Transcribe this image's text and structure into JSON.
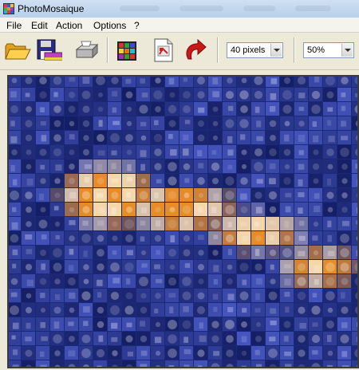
{
  "titlebar": {
    "title": "PhotoMosaique"
  },
  "menu": {
    "items": [
      {
        "label": "File"
      },
      {
        "label": "Edit"
      },
      {
        "label": "Action"
      },
      {
        "label": "Options"
      },
      {
        "label": "?"
      }
    ]
  },
  "toolbar": {
    "buttons": [
      {
        "icon": "open-folder-icon"
      },
      {
        "icon": "save-disk-icon"
      },
      {
        "icon": "print-icon"
      },
      {
        "icon": "color-grid-icon"
      },
      {
        "icon": "image-file-icon"
      },
      {
        "icon": "undo-arrow-icon"
      }
    ],
    "tile_size": {
      "value": "40 pixels"
    },
    "zoom": {
      "value": "50%"
    }
  },
  "colors": {
    "mosaic_base": "#1c2c86",
    "mosaic_highlight": "#f0b35a",
    "frame": "#3b3b3b"
  }
}
